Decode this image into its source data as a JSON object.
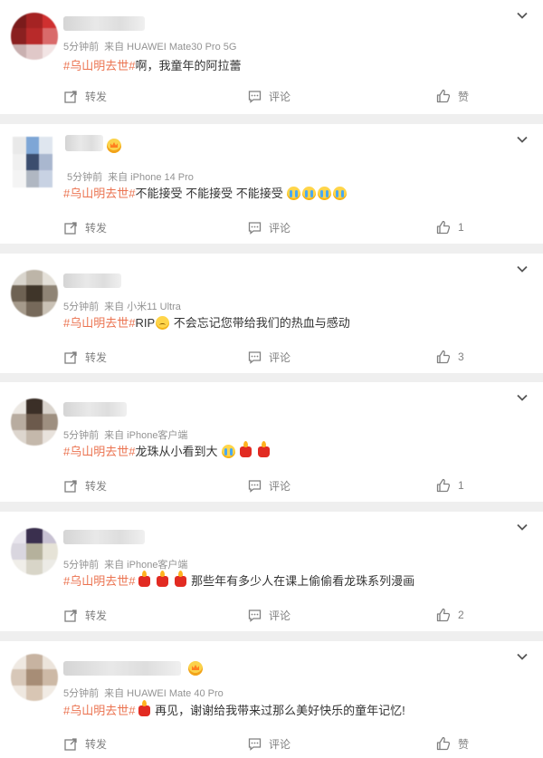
{
  "topic": "#乌山明去世#",
  "action_labels": {
    "repost": "转发",
    "comment": "评论",
    "like_default": "赞"
  },
  "colors": {
    "topic": "#eb7350",
    "meta": "#939393",
    "action": "#808080",
    "background": "#efefef",
    "card": "#ffffff"
  },
  "icons": [
    "chevron-down-icon",
    "repost-icon",
    "comment-icon",
    "like-icon",
    "vip-crown-icon",
    "crying-emoji",
    "candle-emoji",
    "sad-emoji"
  ],
  "posts": [
    {
      "time": "5分钟前",
      "source": "来自 HUAWEI Mate30 Pro 5G",
      "text_after_topic": "啊，我童年的阿拉蕾",
      "emojis": [],
      "likes": "赞"
    },
    {
      "time": "5分钟前",
      "source": "来自 iPhone 14 Pro",
      "text_after_topic": "不能接受 不能接受 不能接受",
      "emojis": [
        "crying",
        "crying",
        "crying",
        "crying"
      ],
      "likes": "1"
    },
    {
      "time": "5分钟前",
      "source": "来自 小米11 Ultra",
      "text_after_topic": "RIP",
      "text_tail": " 不会忘记您带给我们的热血与感动",
      "emojis": [
        "sad"
      ],
      "likes": "3"
    },
    {
      "time": "5分钟前",
      "source": "来自 iPhone客户端",
      "text_after_topic": "龙珠从小看到大",
      "emojis": [
        "crying",
        "candle",
        "candle"
      ],
      "likes": "1"
    },
    {
      "time": "5分钟前",
      "source": "来自 iPhone客户端",
      "text_after_topic": "",
      "text_tail": " 那些年有多少人在课上偷偷看龙珠系列漫画",
      "emojis": [
        "candle",
        "candle",
        "candle"
      ],
      "likes": "2"
    },
    {
      "time": "5分钟前",
      "source": "来自 HUAWEI Mate 40 Pro",
      "text_after_topic": "",
      "text_tail": " 再见，谢谢给我带来过那么美好快乐的童年记忆!",
      "emojis": [
        "candle"
      ],
      "likes": "赞"
    }
  ]
}
